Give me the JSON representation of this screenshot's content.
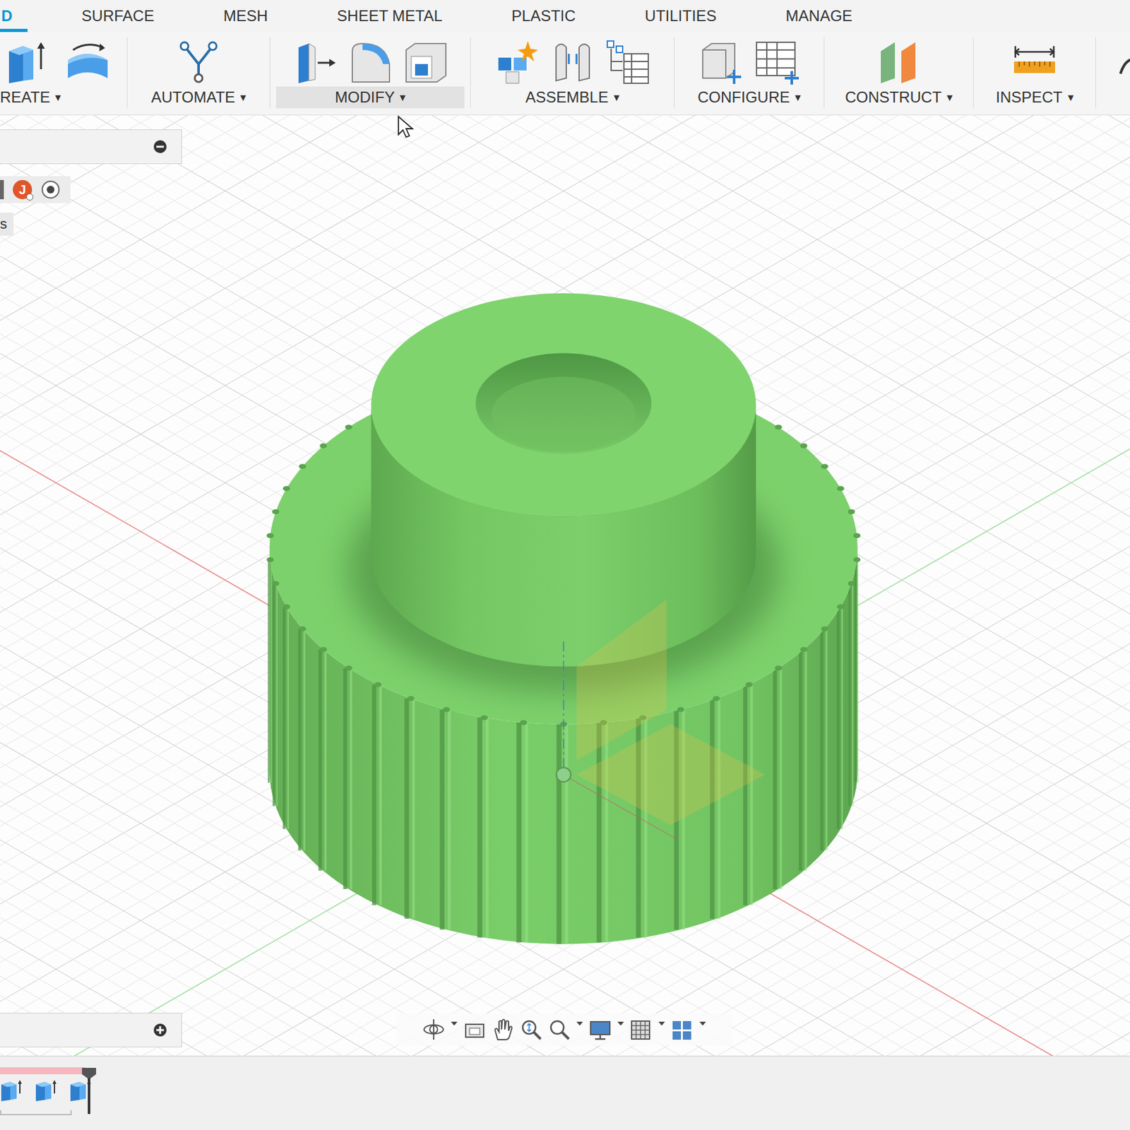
{
  "tabs": [
    {
      "label": "D",
      "selected": true
    },
    {
      "label": "SURFACE",
      "selected": false
    },
    {
      "label": "MESH",
      "selected": false
    },
    {
      "label": "SHEET METAL",
      "selected": false
    },
    {
      "label": "PLASTIC",
      "selected": false
    },
    {
      "label": "UTILITIES",
      "selected": false
    },
    {
      "label": "MANAGE",
      "selected": false
    }
  ],
  "toolbar": {
    "groups": [
      {
        "label": "REATE",
        "arrow": "▾",
        "hovered": false,
        "tools": [
          {
            "kind": "extrude"
          },
          {
            "kind": "revolve"
          }
        ]
      },
      {
        "label": "AUTOMATE",
        "arrow": "▾",
        "hovered": false,
        "tools": [
          {
            "kind": "automate"
          }
        ]
      },
      {
        "label": "MODIFY",
        "arrow": "▾",
        "hovered": true,
        "tools": [
          {
            "kind": "presspull"
          },
          {
            "kind": "fillet"
          },
          {
            "kind": "shell"
          }
        ]
      },
      {
        "label": "ASSEMBLE",
        "arrow": "▾",
        "hovered": false,
        "tools": [
          {
            "kind": "component"
          },
          {
            "kind": "joint"
          },
          {
            "kind": "bom"
          }
        ]
      },
      {
        "label": "CONFIGURE",
        "arrow": "▾",
        "hovered": false,
        "tools": [
          {
            "kind": "config"
          },
          {
            "kind": "table"
          }
        ]
      },
      {
        "label": "CONSTRUCT",
        "arrow": "▾",
        "hovered": false,
        "tools": [
          {
            "kind": "plane"
          }
        ]
      },
      {
        "label": "INSPECT",
        "arrow": "▾",
        "hovered": false,
        "tools": [
          {
            "kind": "measure"
          }
        ]
      }
    ]
  },
  "browser": {
    "avatar": "J",
    "item": "s"
  },
  "timeline": {
    "features": [
      {
        "kind": "extrude"
      },
      {
        "kind": "extrude"
      },
      {
        "kind": "extrude"
      }
    ]
  }
}
